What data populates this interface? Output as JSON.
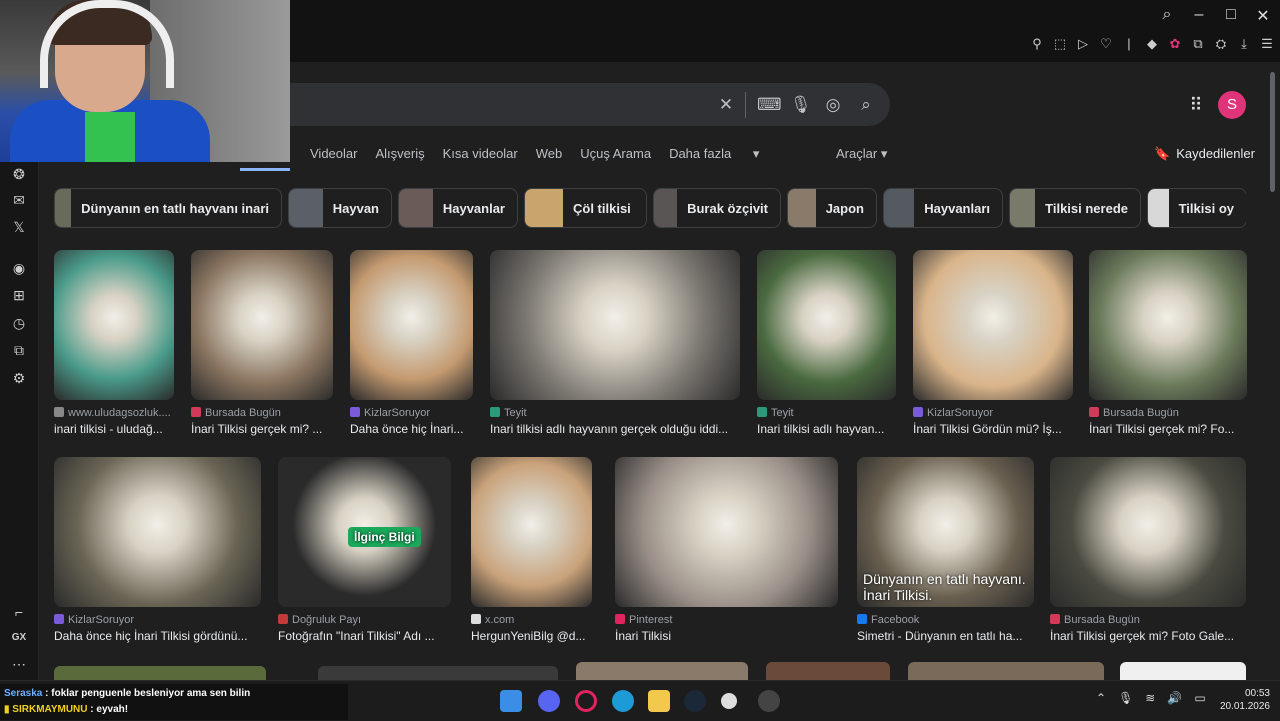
{
  "window": {
    "controls": [
      "search-icon",
      "minimize-icon",
      "maximize-icon",
      "close-icon"
    ]
  },
  "search": {
    "placeholder": ""
  },
  "tabs": [
    "Videolar",
    "Alışveriş",
    "Kısa videolar",
    "Web",
    "Uçuş Arama",
    "Daha fazla"
  ],
  "tools_label": "Araçlar",
  "saved_label": "Kaydedilenler",
  "avatar_letter": "S",
  "chips": [
    {
      "label": "Dünyanın en tatlı hayvanı inari",
      "color": "#6a6a5a"
    },
    {
      "label": "Hayvan",
      "color": "#5a5f68"
    },
    {
      "label": "Hayvanlar",
      "color": "#6a5a58"
    },
    {
      "label": "Çöl tilkisi",
      "color": "#c9a56e"
    },
    {
      "label": "Burak özçivit",
      "color": "#5a5555"
    },
    {
      "label": "Japon",
      "color": "#8a7a6a"
    },
    {
      "label": "Hayvanları",
      "color": "#555a60"
    },
    {
      "label": "Tilkisi nerede",
      "color": "#7a7a6a"
    },
    {
      "label": "Tilkisi oy",
      "color": "#d8d8d8"
    }
  ],
  "results": [
    {
      "source": "www.uludagsozluk....",
      "title": "inari tilkisi - uludağ...",
      "color": "#4a9b8a",
      "src_color": "#888"
    },
    {
      "source": "Bursada Bugün",
      "title": "İnari Tilkisi gerçek mi? ...",
      "color": "#8a7560",
      "src_color": "#d23a5a"
    },
    {
      "source": "KizlarSoruyor",
      "title": "Daha önce hiç İnari...",
      "color": "#c49a70",
      "src_color": "#7a5ad8"
    },
    {
      "source": "Teyit",
      "title": "Inari tilkisi adlı hayvanın gerçek olduğu iddi...",
      "color": "#7a7670",
      "src_color": "#2a9a7a"
    },
    {
      "source": "Teyit",
      "title": "Inari tilkisi adlı hayvan...",
      "color": "#4a6a40",
      "src_color": "#2a9a7a"
    },
    {
      "source": "KizlarSoruyor",
      "title": "İnari Tilkisi Gördün mü? İş...",
      "color": "#d9b48a",
      "src_color": "#7a5ad8"
    },
    {
      "source": "Bursada Bugün",
      "title": "İnari Tilkisi gerçek mi? Fo...",
      "color": "#6a7a5a",
      "src_color": "#d23a5a"
    },
    {
      "source": "KizlarSoruyor",
      "title": "Daha önce hiç İnari Tilkisi gördünü...",
      "color": "#6a6555",
      "src_color": "#7a5ad8"
    },
    {
      "source": "Doğruluk Payı",
      "title": "Fotoğrafın \"Inari Tilkisi\" Adı ...",
      "color": "#2a2a2a",
      "src_color": "#c23a3a",
      "overlay": "İlginç Bilgi"
    },
    {
      "source": "x.com",
      "title": "HergunYeniBilg @d...",
      "color": "#c9a27a",
      "src_color": "#ddd"
    },
    {
      "source": "Pinterest",
      "title": "İnari Tilkisi",
      "color": "#9a8f88",
      "src_color": "#e0245e"
    },
    {
      "source": "Facebook",
      "title": "Simetri - Dünyanın en tatlı ha...",
      "color": "#6a6050",
      "src_color": "#1877f2",
      "overlay": "Dünyanın en tatlı hayvanı.\nİnari Tilkisi."
    },
    {
      "source": "Bursada Bugün",
      "title": "İnari Tilkisi gerçek mi? Foto Gale...",
      "color": "#4a4a40",
      "src_color": "#d23a5a"
    }
  ],
  "chat": [
    {
      "user": "Seraska",
      "msg": "foklar penguenle besleniyor ama sen bilin",
      "color": "#6ab0ff"
    },
    {
      "user": "SIRKMAYMUNU",
      "msg": "eyvah!",
      "color": "#f0d020"
    }
  ],
  "clock": {
    "time": "00:53",
    "date": "20.01.2026"
  },
  "colors": {
    "accent": "#8ab4f8",
    "avatar": "#e0347a"
  }
}
